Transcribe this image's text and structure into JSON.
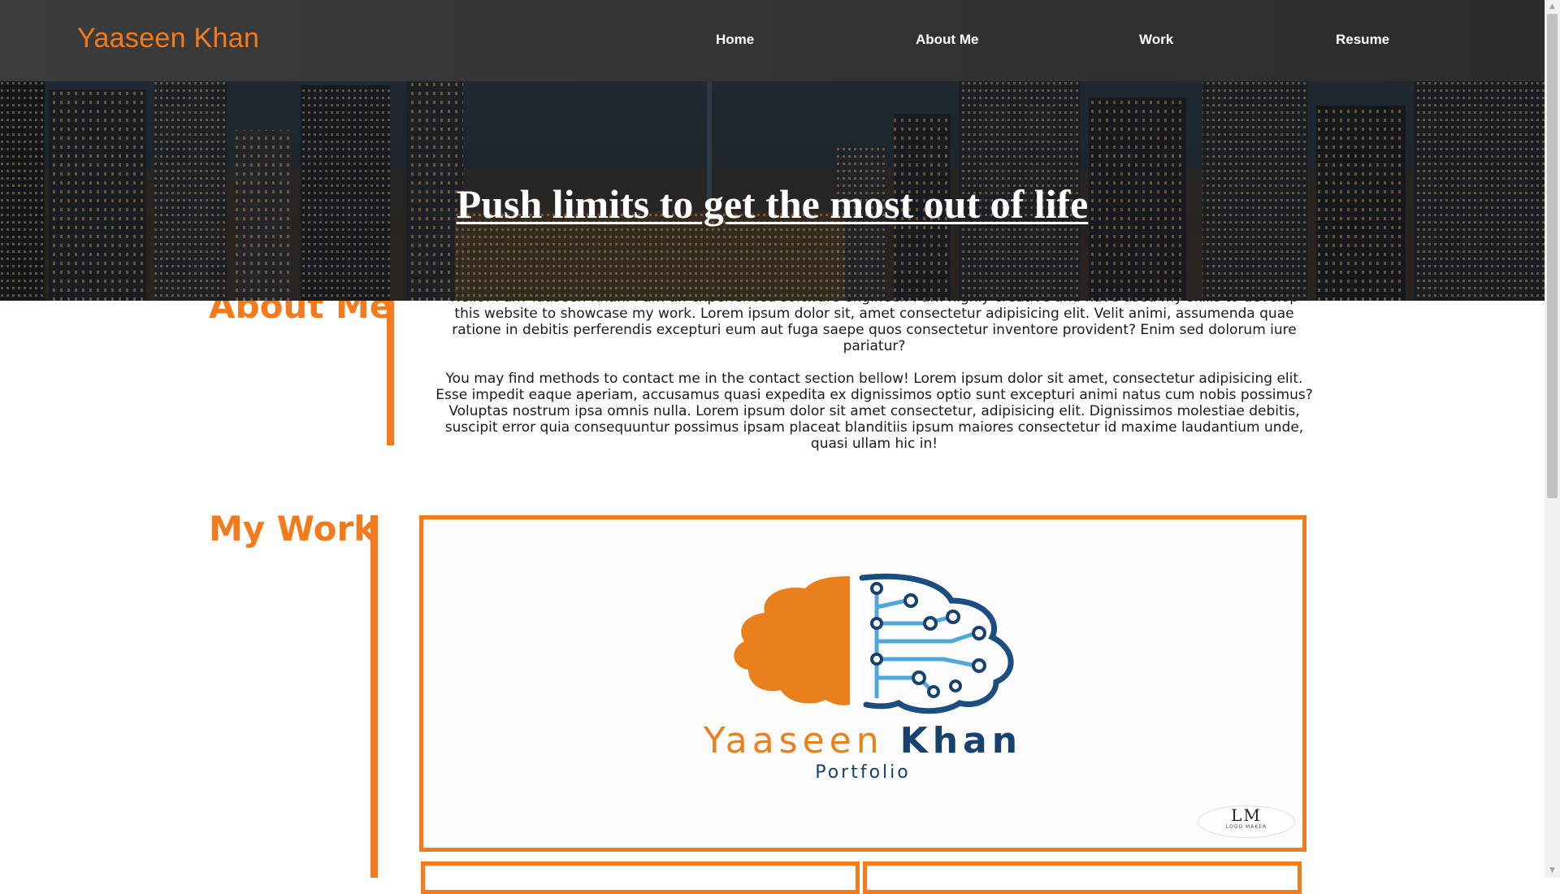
{
  "navbar": {
    "brand": "Yaaseen Khan",
    "links": [
      "Home",
      "About Me",
      "Work",
      "Resume"
    ]
  },
  "hero": {
    "title": "Push limits to get the most out of life"
  },
  "about": {
    "heading": "About Me",
    "paragraphs": [
      "Hello! I am Yaaseen Khan. I am an experienced software engineer. I am highly creative and have used my skills to develop this website to showcase my work. Lorem ipsum dolor sit, amet consectetur adipisicing elit. Velit animi, assumenda quae ratione in debitis perferendis excepturi eum aut fuga saepe quos consectetur inventore provident? Enim sed dolorum iure pariatur?",
      "You may find methods to contact me in the contact section bellow! Lorem ipsum dolor sit amet, consectetur adipisicing elit. Esse impedit eaque aperiam, accusamus quasi expedita ex dignissimos optio sunt excepturi animi natus cum nobis possimus? Voluptas nostrum ipsa omnis nulla. Lorem ipsum dolor sit amet consectetur, adipisicing elit. Dignissimos molestiae debitis, suscipit error quia consequuntur possimus ipsam placeat blanditiis ipsum maiores consectetur id maxime laudantium unde, quasi ullam hic in!"
    ]
  },
  "work": {
    "heading": "My Work",
    "logo": {
      "first_name": "Yaaseen",
      "last_name": "Khan",
      "subtitle": "Portfolio",
      "badge_mark": "LM",
      "badge_text": "LOGO MAKER"
    }
  },
  "colors": {
    "accent": "#f57a1c",
    "navbar": "#343434",
    "logo_orange": "#e9801c",
    "logo_blue": "#17416e"
  },
  "icons": [
    "brain-logo-icon",
    "scroll-up-arrow-icon",
    "scroll-down-arrow-icon"
  ]
}
